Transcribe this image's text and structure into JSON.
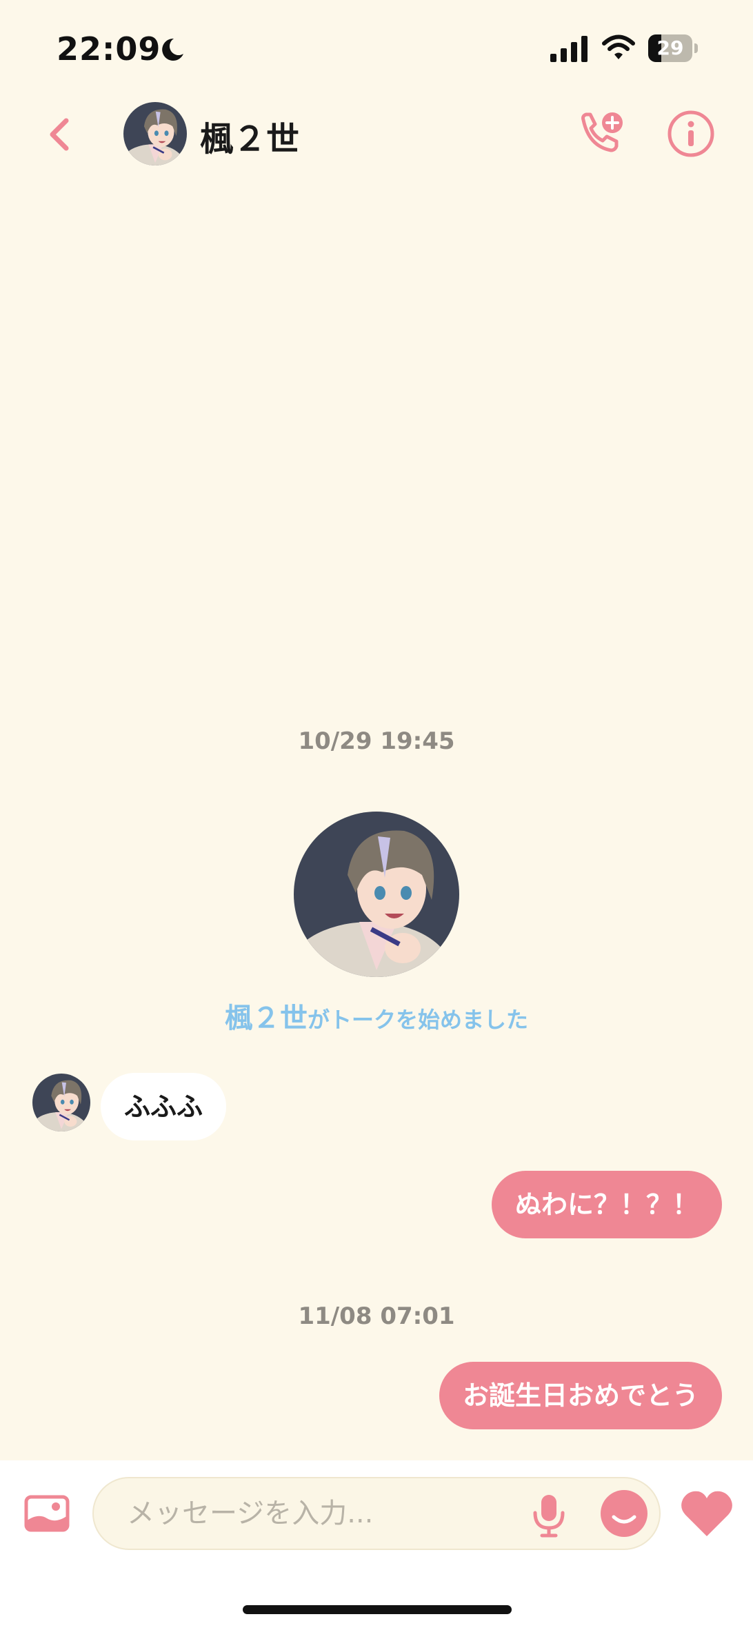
{
  "status_bar": {
    "time": "22:09",
    "battery": "29",
    "battery_level": 0.29
  },
  "header": {
    "contact_name": "楓２世"
  },
  "chat": {
    "timestamp_1": "10/29 19:45",
    "started_name": "楓２世",
    "started_suffix": "がトークを始めました",
    "incoming_1": "ふふふ",
    "outgoing_1": "ぬわに？！？！",
    "timestamp_2": "11/08 07:01",
    "outgoing_2": "お誕生日おめでとう"
  },
  "input": {
    "placeholder": "メッセージを入力..."
  },
  "colors": {
    "accent": "#ef8794",
    "background": "#fdf8ea",
    "system_text": "#85c3eb"
  }
}
